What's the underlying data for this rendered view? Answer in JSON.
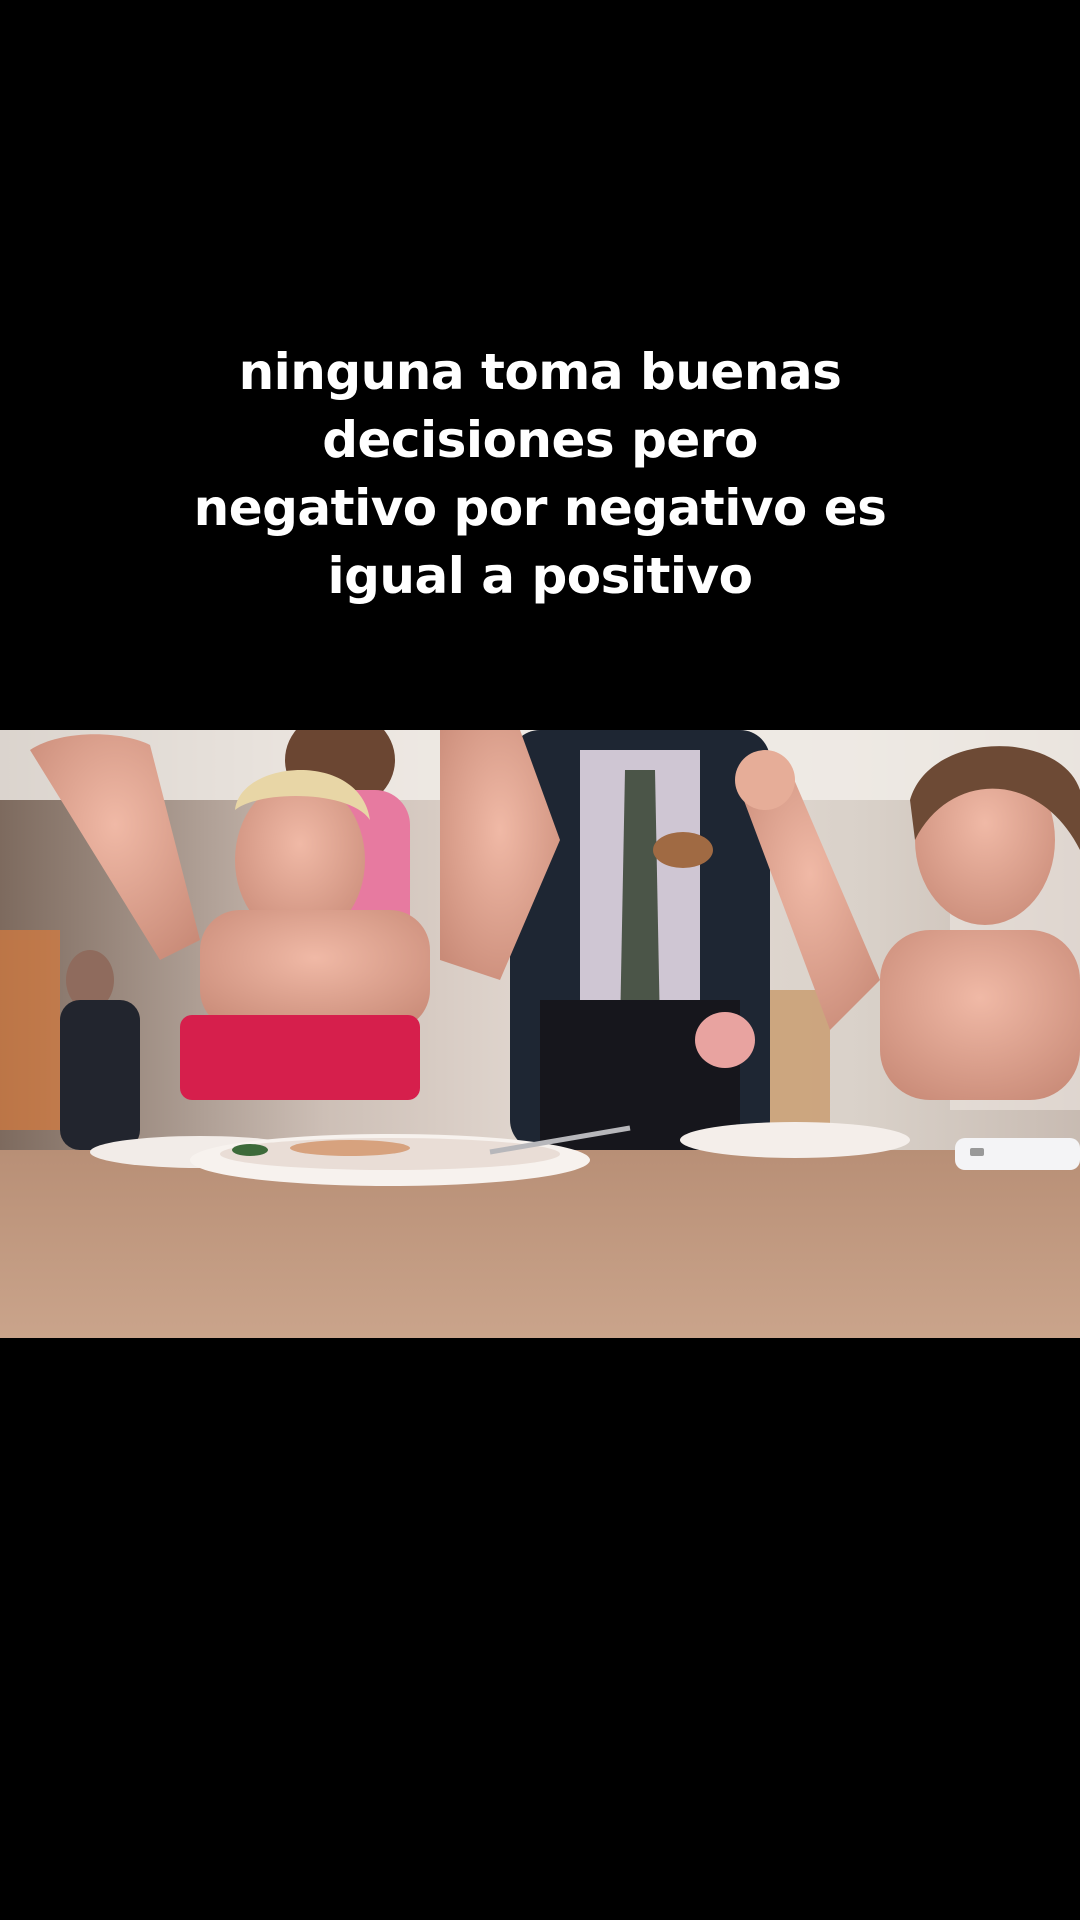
{
  "caption": {
    "lines": [
      "ninguna toma buenas",
      "decisiones pero",
      "negativo por negativo es",
      "igual a positivo"
    ]
  },
  "video": {
    "description_icon": "video-frame"
  },
  "colors": {
    "background": "#000000",
    "caption_text": "#ffffff"
  }
}
